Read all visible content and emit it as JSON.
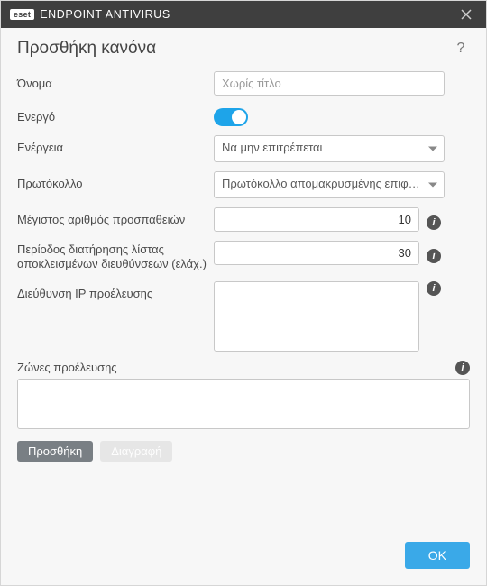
{
  "titlebar": {
    "badge": "eset",
    "product": "ENDPOINT ANTIVIRUS"
  },
  "heading": "Προσθήκη κανόνα",
  "help_glyph": "?",
  "fields": {
    "name_label": "Όνομα",
    "name_placeholder": "Χωρίς τίτλο",
    "name_value": "",
    "enabled_label": "Ενεργό",
    "enabled_value": true,
    "action_label": "Ενέργεια",
    "action_selected": "Να μην επιτρέπεται",
    "protocol_label": "Πρωτόκολλο",
    "protocol_selected": "Πρωτόκολλο απομακρυσμένης επιφ…",
    "max_attempts_label": "Μέγιστος αριθμός προσπαθειών",
    "max_attempts_value": "10",
    "block_retain_label": "Περίοδος διατήρησης λίστας αποκλεισμένων διευθύνσεων (ελάχ.)",
    "block_retain_value": "30",
    "source_ip_label": "Διεύθυνση IP προέλευσης",
    "source_ip_value": "",
    "source_zones_label": "Ζώνες προέλευσης",
    "source_zones_value": ""
  },
  "buttons": {
    "add": "Προσθήκη",
    "delete": "Διαγραφή",
    "ok": "OK"
  },
  "info_glyph": "i"
}
